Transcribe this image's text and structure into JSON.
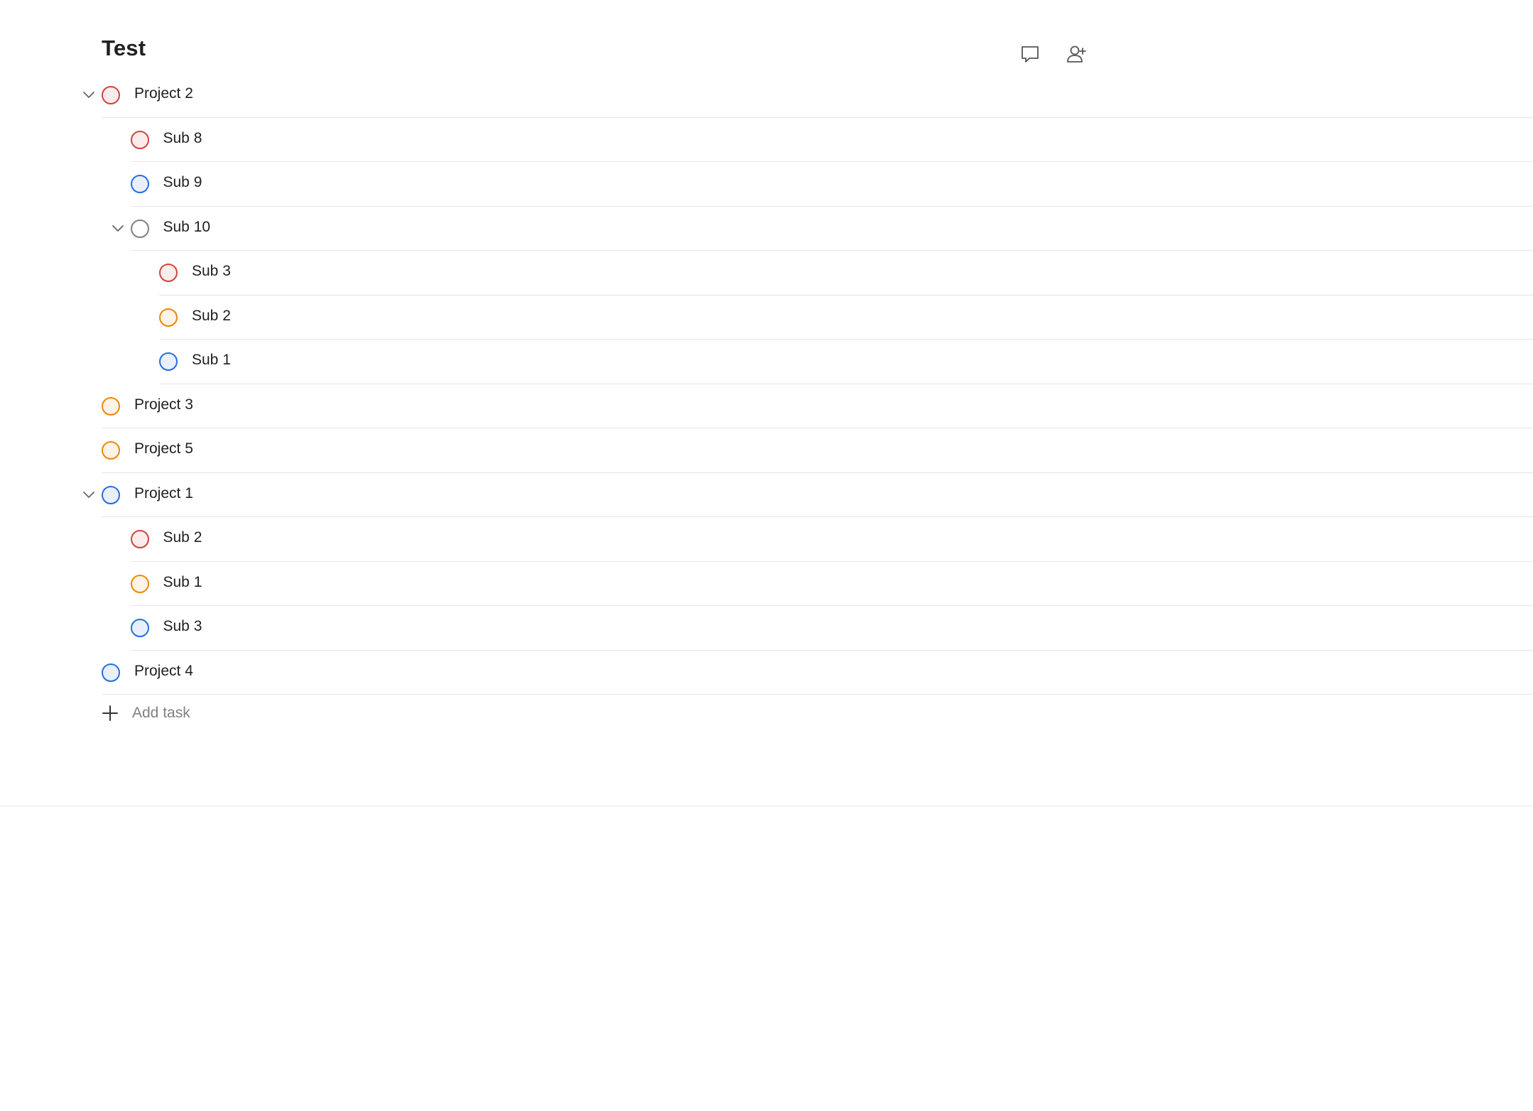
{
  "project": {
    "title": "Test"
  },
  "header": {
    "actions": [
      {
        "name": "comments-icon",
        "label": "Comments"
      },
      {
        "name": "share-icon",
        "label": "Share"
      }
    ]
  },
  "tasks": [
    {
      "id": "t1",
      "label": "Project 2",
      "depth": 0,
      "priority": "p1",
      "expanded": true
    },
    {
      "id": "t2",
      "label": "Sub 8",
      "depth": 1,
      "priority": "p1"
    },
    {
      "id": "t3",
      "label": "Sub 9",
      "depth": 1,
      "priority": "p3"
    },
    {
      "id": "t4",
      "label": "Sub 10",
      "depth": 1,
      "priority": "p4",
      "expanded": true
    },
    {
      "id": "t5",
      "label": "Sub 3",
      "depth": 2,
      "priority": "p1"
    },
    {
      "id": "t6",
      "label": "Sub 2",
      "depth": 2,
      "priority": "p2"
    },
    {
      "id": "t7",
      "label": "Sub 1",
      "depth": 2,
      "priority": "p3"
    },
    {
      "id": "t8",
      "label": "Project 3",
      "depth": 0,
      "priority": "p2"
    },
    {
      "id": "t9",
      "label": "Project 5",
      "depth": 0,
      "priority": "p2"
    },
    {
      "id": "t10",
      "label": "Project 1",
      "depth": 0,
      "priority": "p3",
      "expanded": true
    },
    {
      "id": "t11",
      "label": "Sub 2",
      "depth": 1,
      "priority": "p1"
    },
    {
      "id": "t12",
      "label": "Sub 1",
      "depth": 1,
      "priority": "p2"
    },
    {
      "id": "t13",
      "label": "Sub 3",
      "depth": 1,
      "priority": "p3"
    },
    {
      "id": "t14",
      "label": "Project 4",
      "depth": 0,
      "priority": "p3"
    }
  ],
  "add_task": {
    "label": "Add task"
  },
  "colors": {
    "priority_1": "#d1453b",
    "priority_2": "#eb8909",
    "priority_3": "#246fe0",
    "priority_4": "#808080",
    "divider": "#e6e6e6"
  }
}
